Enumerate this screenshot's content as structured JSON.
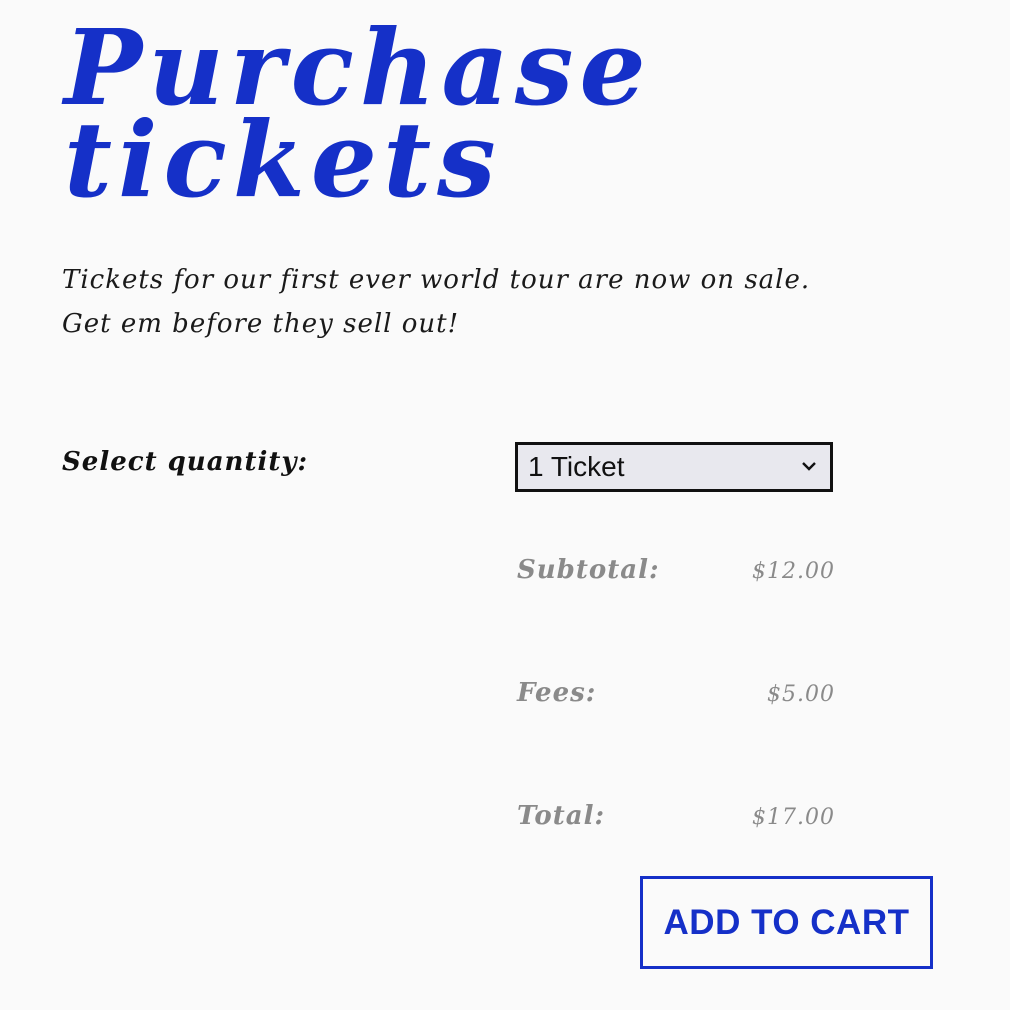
{
  "colors": {
    "accent": "#1530c8",
    "background": "#fafafa",
    "text": "#111111",
    "muted": "#8a8a8a",
    "select_fill": "#e8e8ee"
  },
  "header": {
    "title": "Purchase tickets",
    "subtitle_line1": "Tickets for our first ever world tour are now on sale.",
    "subtitle_line2": "Get em before they sell out!"
  },
  "quantity": {
    "label": "Select quantity:",
    "selected": "1 Ticket",
    "icon": "chevron-down-icon"
  },
  "summary": {
    "subtotal_label": "Subtotal:",
    "subtotal_value": "$12.00",
    "fees_label": "Fees:",
    "fees_value": "$5.00",
    "total_label": "Total:",
    "total_value": "$17.00"
  },
  "actions": {
    "add_to_cart_label": "ADD TO CART"
  }
}
